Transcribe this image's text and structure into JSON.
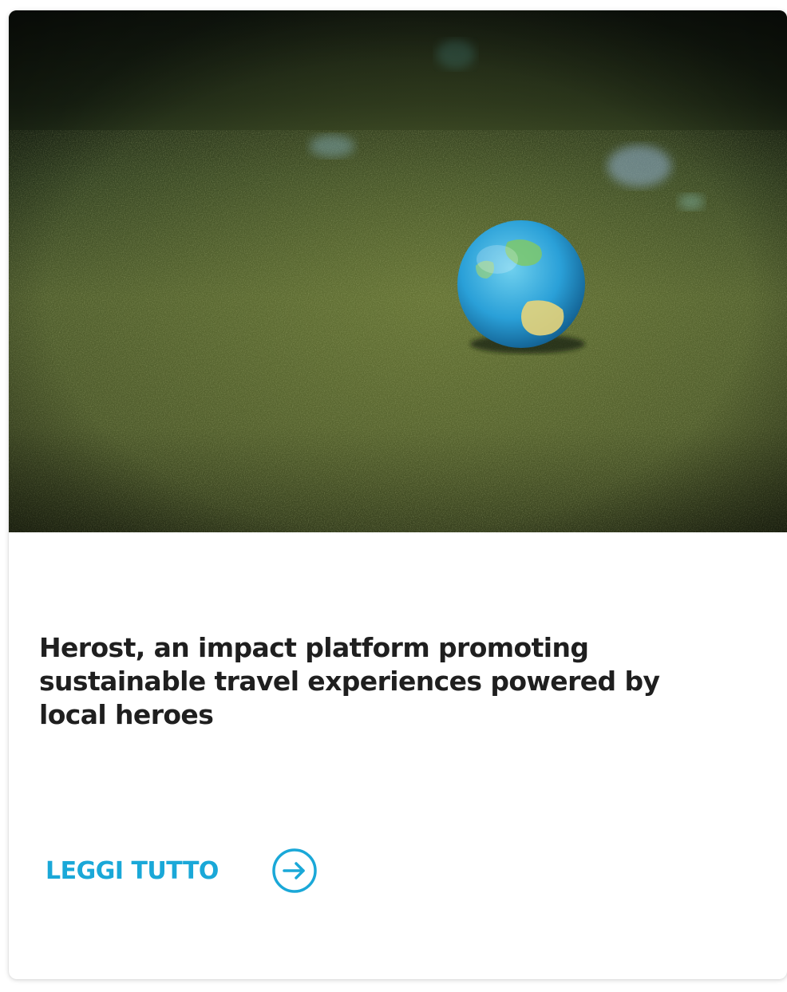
{
  "card": {
    "image": {
      "icon": "globe-on-grass-photo"
    },
    "title": "Herost, an impact platform promoting sustainable travel experiences powered by local heroes",
    "cta": {
      "label": "LEGGI TUTTO",
      "icon": "arrow-right-circle-icon"
    }
  },
  "colors": {
    "accent": "#1aa8d8",
    "title_text": "#1f1f1f",
    "card_background": "#ffffff"
  }
}
